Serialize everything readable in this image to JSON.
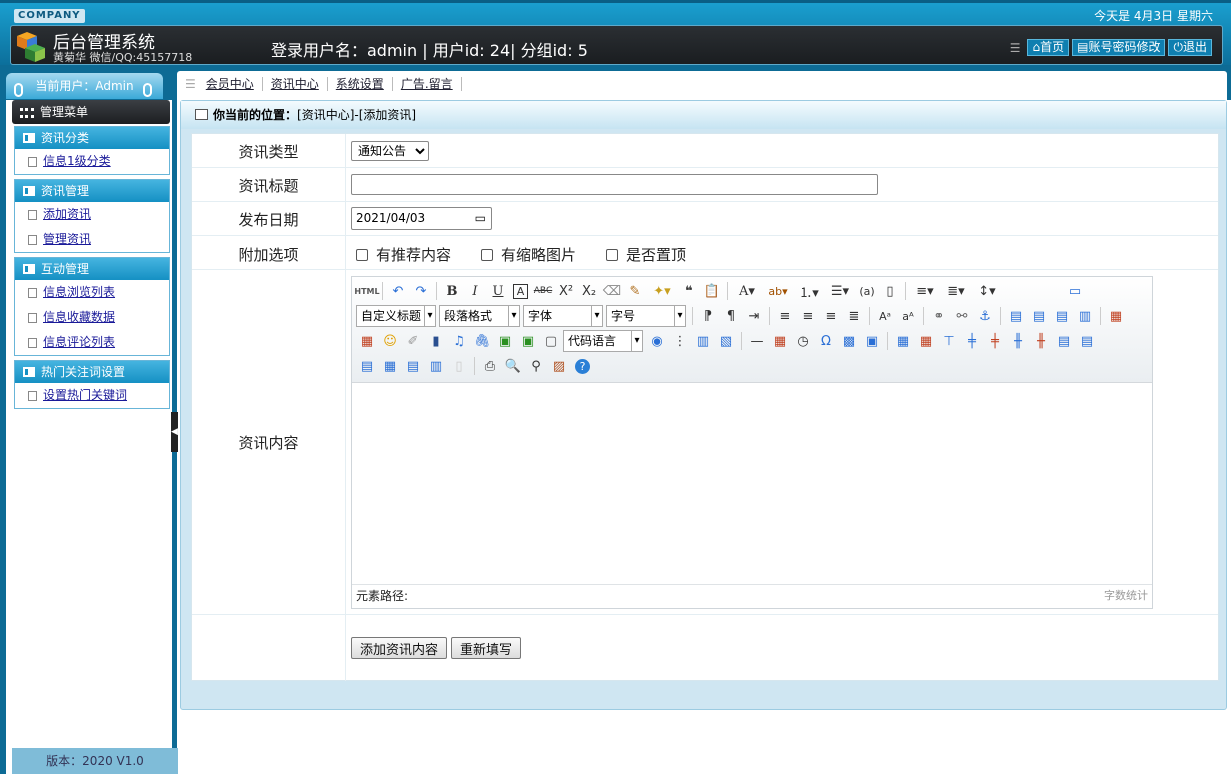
{
  "header": {
    "company_tag": "COMPANY",
    "date_text": "今天是 4月3日  星期六",
    "system_title": "后台管理系统",
    "system_sub": "黄菊华 微信/QQ:45157718",
    "login_info": "登录用户名：admin | 用户id: 24| 分组id: 5",
    "buttons": {
      "home": "首页",
      "account": "账号密码修改",
      "logout": "退出"
    }
  },
  "nav": {
    "current_user": "当前用户：Admin",
    "items": [
      "会员中心",
      "资讯中心",
      "系统设置",
      "广告.留言"
    ]
  },
  "sidebar": {
    "menu_title": "管理菜单",
    "groups": [
      {
        "title": "资讯分类",
        "items": [
          "信息1级分类"
        ]
      },
      {
        "title": "资讯管理",
        "items": [
          "添加资讯",
          "管理资讯"
        ]
      },
      {
        "title": "互动管理",
        "items": [
          "信息浏览列表",
          "信息收藏数据",
          "信息评论列表"
        ]
      },
      {
        "title": "热门关注词设置",
        "items": [
          "设置热门关键词"
        ]
      }
    ],
    "version": "版本：2020 V1.0"
  },
  "breadcrumb": {
    "label": "你当前的位置：",
    "path": "[资讯中心]-[添加资讯]"
  },
  "form": {
    "type_label": "资讯类型",
    "type_value": "通知公告",
    "title_label": "资讯标题",
    "title_value": "",
    "date_label": "发布日期",
    "date_value": "2021/04/03",
    "options_label": "附加选项",
    "options": [
      "有推荐内容",
      "有缩略图片",
      "是否置顶"
    ],
    "content_label": "资讯内容",
    "submit_label": "添加资讯内容",
    "reset_label": "重新填写"
  },
  "editor": {
    "combos": {
      "heading": "自定义标题",
      "paragraph": "段落格式",
      "font": "字体",
      "size": "字号",
      "code": "代码语言"
    },
    "html_label": "HTML",
    "path_label": "元素路径:",
    "count_label": "字数统计"
  }
}
